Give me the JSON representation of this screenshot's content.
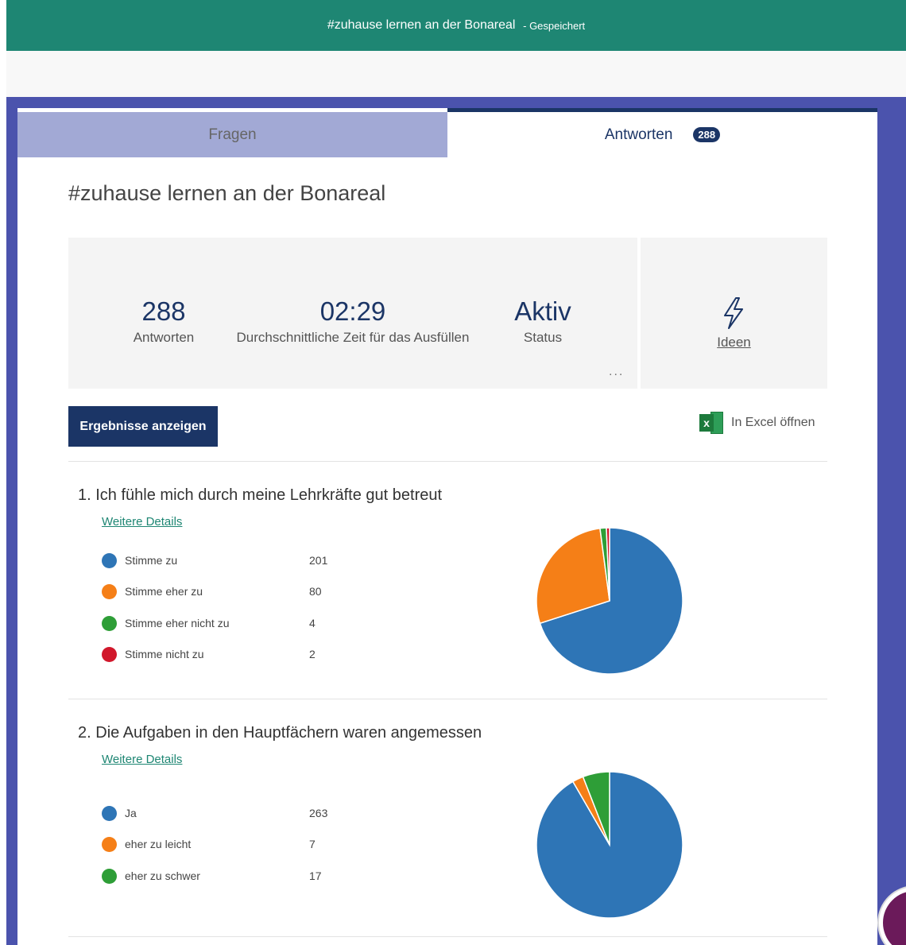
{
  "header": {
    "title": "#zuhause lernen an der Bonareal",
    "status": "Gespeichert",
    "separator": "-"
  },
  "tabs": {
    "questions_label": "Fragen",
    "responses_label": "Antworten",
    "responses_count": "288"
  },
  "form_title": "#zuhause lernen an der Bonareal",
  "summary": {
    "responses": {
      "value": "288",
      "label": "Antworten"
    },
    "avg_time": {
      "value": "02:29",
      "label": "Durchschnittliche Zeit für das Ausfüllen"
    },
    "status": {
      "value": "Aktiv",
      "label": "Status"
    },
    "more": "...",
    "ideas_label": "Ideen"
  },
  "actions": {
    "view_results": "Ergebnisse anzeigen",
    "open_excel": "In Excel öffnen"
  },
  "colors": {
    "blue": "#2e75b6",
    "orange": "#f57f17",
    "green": "#2e9e37",
    "red": "#d1172b"
  },
  "questions": [
    {
      "number": "1.",
      "title": "Ich fühle mich durch meine Lehrkräfte gut betreut",
      "details_link": "Weitere Details",
      "options": [
        {
          "label": "Stimme zu",
          "count": "201",
          "value": 201,
          "color": "#2e75b6"
        },
        {
          "label": "Stimme eher zu",
          "count": "80",
          "value": 80,
          "color": "#f57f17"
        },
        {
          "label": "Stimme eher nicht zu",
          "count": "4",
          "value": 4,
          "color": "#2e9e37"
        },
        {
          "label": "Stimme nicht zu",
          "count": "2",
          "value": 2,
          "color": "#d1172b"
        }
      ]
    },
    {
      "number": "2.",
      "title": "Die Aufgaben in den Hauptfächern waren angemessen",
      "details_link": "Weitere Details",
      "options": [
        {
          "label": "Ja",
          "count": "263",
          "value": 263,
          "color": "#2e75b6"
        },
        {
          "label": "eher zu leicht",
          "count": "7",
          "value": 7,
          "color": "#f57f17"
        },
        {
          "label": "eher zu schwer",
          "count": "17",
          "value": 17,
          "color": "#2e9e37"
        }
      ]
    }
  ]
}
